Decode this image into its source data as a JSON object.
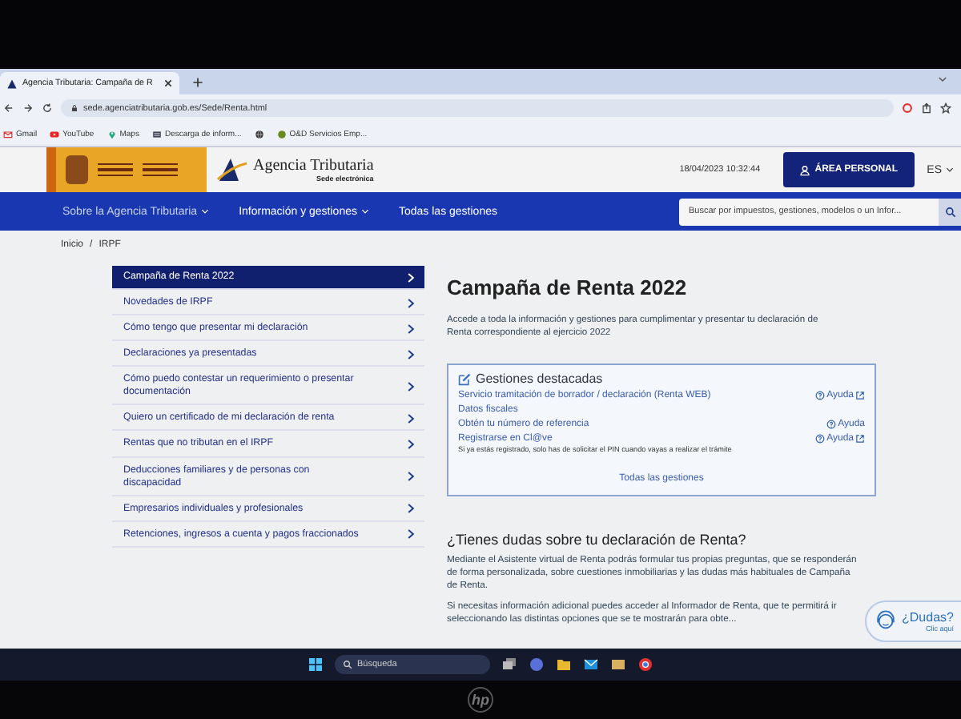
{
  "browser": {
    "tab_title": "Agencia Tributaria: Campaña de R",
    "url": "sede.agenciatributaria.gob.es/Sede/Renta.html",
    "bookmarks": [
      {
        "kind": "gmail",
        "label": "Gmail"
      },
      {
        "kind": "youtube",
        "label": "YouTube"
      },
      {
        "kind": "maps",
        "label": "Maps"
      },
      {
        "kind": "doc",
        "label": "Descarga de inform..."
      },
      {
        "kind": "globe"
      },
      {
        "kind": "site",
        "label": "O&D Servicios Emp..."
      }
    ]
  },
  "header": {
    "brand": "Agencia Tributaria",
    "brand_sub": "Sede electrónica",
    "datetime": "18/04/2023 10:32:44",
    "login_button": "ÁREA PERSONAL",
    "language": "ES"
  },
  "nav": {
    "items": [
      {
        "label": "Sobre la Agencia Tributaria",
        "dropdown": true
      },
      {
        "label": "Información y gestiones",
        "dropdown": true
      },
      {
        "label": "Todas las gestiones",
        "dropdown": false
      }
    ],
    "search": {
      "placeholder": "Buscar por impuestos, gestiones, modelos o un Infor..."
    }
  },
  "breadcrumb": {
    "items": [
      "Inicio",
      "IRPF"
    ],
    "separator": "/"
  },
  "sidebar": {
    "items": [
      {
        "label": "Campaña de Renta 2022",
        "selected": true
      },
      {
        "label": "Novedades de IRPF",
        "selected": false
      },
      {
        "label": "Cómo tengo que presentar mi declaración",
        "selected": false
      },
      {
        "label": "Declaraciones ya presentadas",
        "selected": false
      },
      {
        "label": "Cómo puedo contestar un requerimiento o presentar documentación",
        "selected": false
      },
      {
        "label": "Quiero un certificado de mi declaración de renta",
        "selected": false
      },
      {
        "label": "Rentas que no tributan en el IRPF",
        "selected": false
      },
      {
        "label": "Deducciones familiares y de personas con discapacidad",
        "selected": false
      },
      {
        "label": "Empresarios individuales y profesionales",
        "selected": false
      },
      {
        "label": "Retenciones, ingresos a cuenta y pagos fraccionados",
        "selected": false
      }
    ]
  },
  "main": {
    "title": "Campaña de Renta 2022",
    "intro": "Accede a toda la información y gestiones para cumplimentar y presentar tu declaración de Renta correspondiente al ejercicio 2022",
    "featured": {
      "title": "Gestiones destacadas",
      "items": [
        {
          "label": "Servicio tramitación de borrador / declaración (Renta WEB)",
          "help": "Ayuda",
          "external": true
        },
        {
          "label": "Datos fiscales"
        },
        {
          "label": "Obtén tu número de referencia",
          "help": "Ayuda",
          "external": false
        },
        {
          "label": "Registrarse en Cl@ve",
          "help": "Ayuda",
          "external": true,
          "note": "Si ya estás registrado, solo has de solicitar el PIN cuando vayas a realizar el trámite"
        }
      ],
      "all_link": "Todas las gestiones"
    },
    "questions": {
      "title": "¿Tienes dudas sobre tu declaración de Renta?",
      "paragraphs": [
        "Mediante el Asistente virtual de Renta podrás formular tus propias preguntas, que se responderán de forma personalizada, sobre cuestiones inmobiliarias y las dudas más habituales de Campaña de Renta.",
        "Si necesitas información adicional puedes acceder al Informador de Renta, que te permitirá ir seleccionando las distintas opciones que se te mostrarán para obte..."
      ]
    }
  },
  "help_widget": {
    "title": "¿Dudas?",
    "link": "Clic aquí"
  },
  "taskbar": {
    "search_placeholder": "Búsqueda"
  },
  "device": {
    "logo": "hp"
  }
}
